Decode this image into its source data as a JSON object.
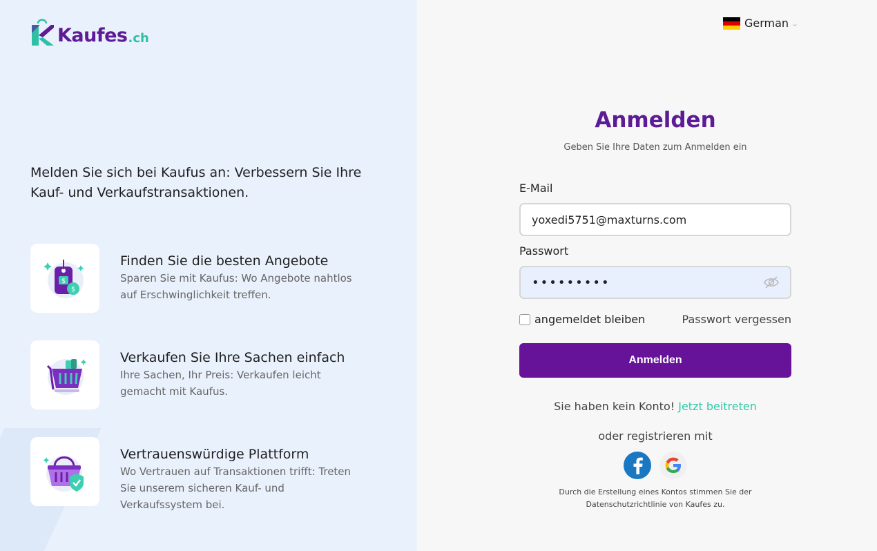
{
  "brand": {
    "name": "Kaufes",
    "tld": ".ch"
  },
  "language": {
    "label": "German",
    "flag": [
      "#000000",
      "#dd0000",
      "#ffce00"
    ]
  },
  "left": {
    "tagline": "Melden Sie sich bei Kaufus an: Verbessern Sie Ihre Kauf- und Verkaufstransaktionen.",
    "features": [
      {
        "icon": "price-tag-icon",
        "title": "Finden Sie die besten Angebote",
        "desc": "Sparen Sie mit Kaufus: Wo Angebote nahtlos auf Erschwinglichkeit treffen."
      },
      {
        "icon": "shopping-basket-icon",
        "title": "Verkaufen Sie Ihre Sachen einfach",
        "desc": "Ihre Sachen, Ihr Preis: Verkaufen leicht gemacht mit Kaufus."
      },
      {
        "icon": "secure-basket-icon",
        "title": "Vertrauenswürdige Plattform",
        "desc": "Wo Vertrauen auf Transaktionen trifft: Treten Sie unserem sicheren Kauf- und Verkaufssystem bei."
      }
    ]
  },
  "form": {
    "title": "Anmelden",
    "subtitle": "Geben Sie Ihre Daten zum Anmelden ein",
    "email_label": "E-Mail",
    "email_value": "yoxedi5751@maxturns.com",
    "password_label": "Passwort",
    "password_value": "•••••••••",
    "remember_label": "angemeldet bleiben",
    "forgot_label": "Passwort vergessen",
    "submit_label": "Anmelden",
    "no_account_text": "Sie haben kein Konto!",
    "join_label": "Jetzt beitreten",
    "or_register": "oder registrieren mit",
    "terms_line1": "Durch die Erstellung eines Kontos stimmen Sie der",
    "terms_line2": "Datenschutzrichtlinie von Kaufes zu."
  },
  "colors": {
    "primary": "#66139a",
    "accent": "#2fc9a8",
    "left_bg": "#e9f1fc"
  }
}
